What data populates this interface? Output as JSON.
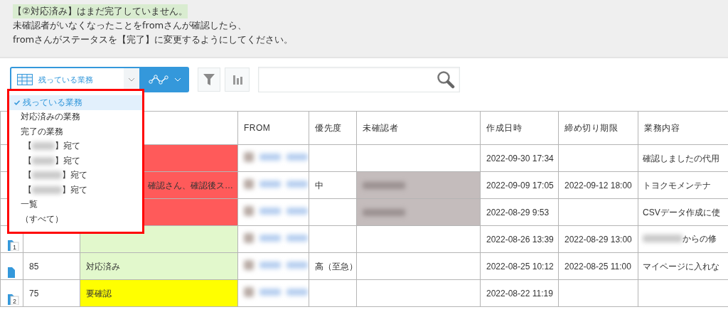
{
  "notice": {
    "highlight": "【②対応済み】はまだ完了していません。",
    "lines": [
      "未確認者がいなくなったことをfromさんが確認したら、",
      "fromさんがステータスを【完了】に変更するようにしてください。"
    ]
  },
  "toolbar": {
    "view": "残っている業務"
  },
  "view_menu": {
    "items": [
      {
        "kind": "plain",
        "label": "残っている業務",
        "selected": true
      },
      {
        "kind": "plain",
        "label": "対応済みの業務",
        "selected": false
      },
      {
        "kind": "plain",
        "label": "完了の業務",
        "selected": false
      },
      {
        "kind": "redacted",
        "prefix": "【",
        "suffix": "】宛て",
        "selected": false
      },
      {
        "kind": "redacted",
        "prefix": "【",
        "suffix": "】宛て",
        "selected": false
      },
      {
        "kind": "redacted",
        "prefix": "【",
        "suffix": "】宛て",
        "selected": false
      },
      {
        "kind": "redacted",
        "prefix": "【",
        "suffix": "】宛て",
        "selected": false
      },
      {
        "kind": "plain",
        "label": "一覧",
        "selected": false
      },
      {
        "kind": "plain",
        "label": "（すべて）",
        "selected": false
      }
    ]
  },
  "table": {
    "columns": [
      "FROM",
      "優先度",
      "未確認者",
      "作成日時",
      "締め切り期限",
      "業務内容"
    ],
    "rows": [
      {
        "color": "#ff5a5a",
        "from_redacted": true,
        "unconfirmed_redacted": false,
        "created": "2022-09-30 17:34",
        "content": "確認しましたの代用"
      },
      {
        "color": "#ff5a5a",
        "status": "確認さん、確認後ス…",
        "status_clipped": true,
        "from_redacted": true,
        "priority": "中",
        "unconfirmed_redacted": true,
        "created": "2022-09-09 17:05",
        "deadline": "2022-09-12 18:00",
        "content": "トヨクモメンテナ"
      },
      {
        "color": "#ff5a5a",
        "from_redacted": true,
        "unconfirmed_redacted": true,
        "created": "2022-08-29 9:53",
        "content": "CSVデータ作成に使"
      },
      {
        "color": "#e2f8cc",
        "icon": {
          "kind": "doc",
          "badge": "1"
        },
        "from_redacted": true,
        "unconfirmed_redacted": false,
        "created": "2022-08-26 13:39",
        "deadline": "2022-08-29 13:00",
        "content_redacted": true,
        "content": "からの修"
      },
      {
        "color": "#e2f8cc",
        "icon": {
          "kind": "doc"
        },
        "number": "85",
        "status": "対応済み",
        "status_clipped": false,
        "from_redacted": true,
        "priority": "高（至急）",
        "unconfirmed_redacted": false,
        "created": "2022-08-25 10:12",
        "deadline": "2022-08-25 11:00",
        "content": "マイページに入れな"
      },
      {
        "color": "#ffff00",
        "icon": {
          "kind": "doc",
          "badge": "2"
        },
        "number": "75",
        "status": "要確認",
        "status_clipped": false,
        "from_redacted": true,
        "unconfirmed_redacted": false,
        "created": "2022-08-22 11:19"
      }
    ]
  }
}
